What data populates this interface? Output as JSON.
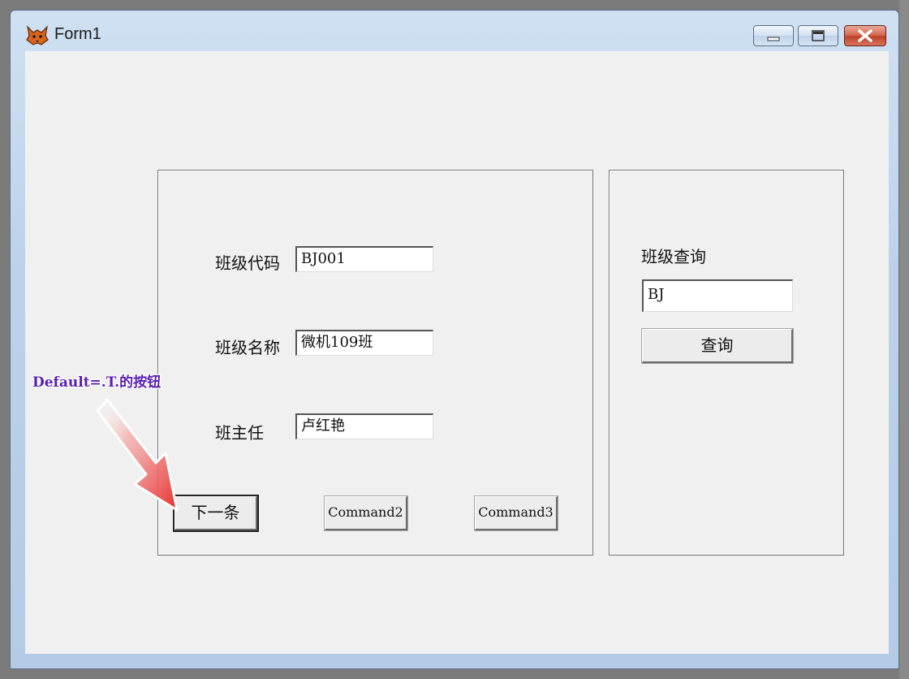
{
  "window": {
    "title": "Form1",
    "controls": {
      "minimize": "minimize",
      "maximize": "maximize",
      "close": "close"
    }
  },
  "form": {
    "class_code_label": "班级代码",
    "class_code_value": "BJ001",
    "class_name_label": "班级名称",
    "class_name_value": "微机109班",
    "teacher_label": "班主任",
    "teacher_value": "卢红艳",
    "buttons": {
      "next": "下一条",
      "command2": "Command2",
      "command3": "Command3"
    }
  },
  "query": {
    "label": "班级查询",
    "input_value": "BJ",
    "button": "查询"
  },
  "annotation": {
    "text": "Default=.T.的按钮",
    "color": "#5a1fb0",
    "arrow_color": "#e8302f"
  }
}
